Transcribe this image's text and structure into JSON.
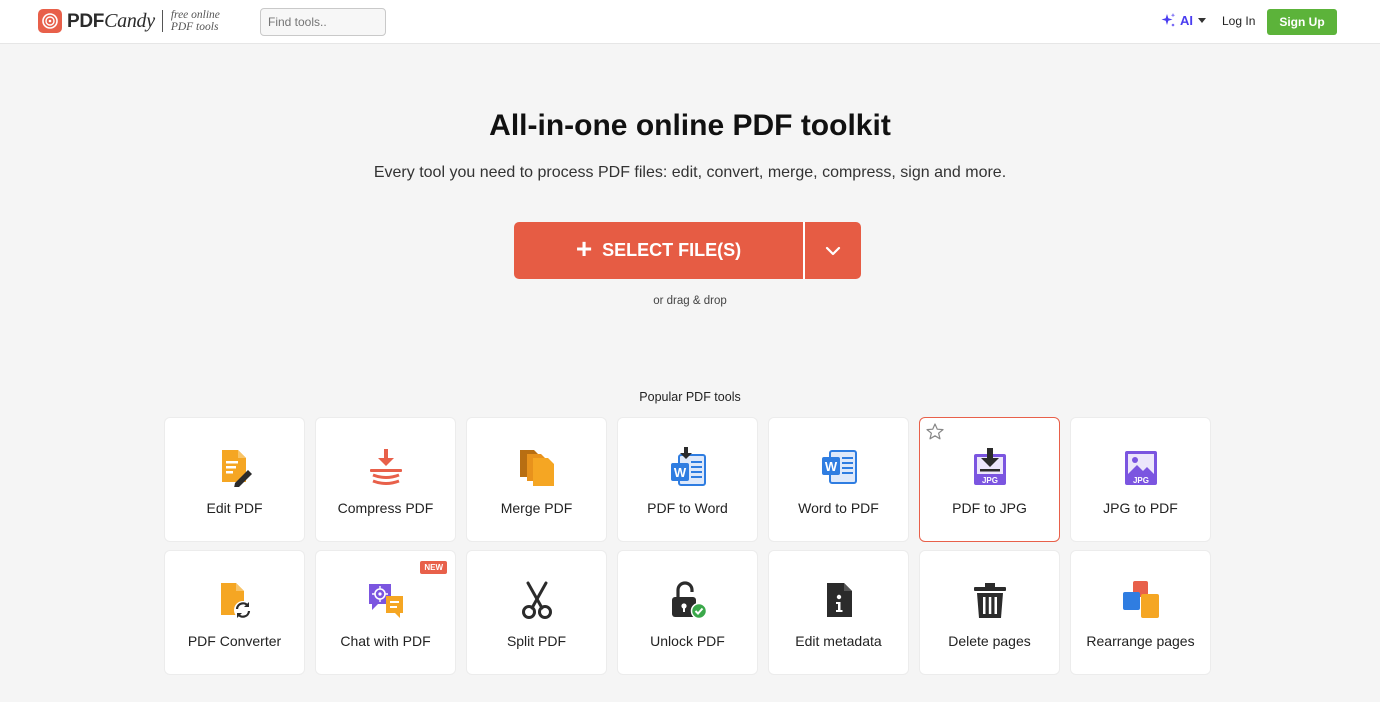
{
  "header": {
    "logo_text_a": "PDF",
    "logo_text_b": "Candy",
    "tagline_1": "free online",
    "tagline_2": "PDF tools",
    "search_placeholder": "Find tools..",
    "ai_label": "AI",
    "login_label": "Log In",
    "signup_label": "Sign Up"
  },
  "hero": {
    "title": "All-in-one online PDF toolkit",
    "subtitle": "Every tool you need to process PDF files: edit, convert, merge, compress, sign and more.",
    "select_label": "SELECT FILE(S)",
    "drag_drop": "or drag & drop"
  },
  "tools": {
    "heading": "Popular PDF tools",
    "items": [
      {
        "label": "Edit PDF",
        "icon": "edit-pdf-icon"
      },
      {
        "label": "Compress PDF",
        "icon": "compress-icon"
      },
      {
        "label": "Merge PDF",
        "icon": "merge-icon"
      },
      {
        "label": "PDF to Word",
        "icon": "pdf-to-word-icon"
      },
      {
        "label": "Word to PDF",
        "icon": "word-icon"
      },
      {
        "label": "PDF to JPG",
        "icon": "pdf-to-jpg-icon",
        "badge_text": "JPG"
      },
      {
        "label": "JPG to PDF",
        "icon": "jpg-image-icon",
        "badge_text": "JPG"
      },
      {
        "label": "PDF Converter",
        "icon": "converter-icon"
      },
      {
        "label": "Chat with PDF",
        "icon": "chat-icon",
        "badge": "NEW"
      },
      {
        "label": "Split PDF",
        "icon": "scissors-icon"
      },
      {
        "label": "Unlock PDF",
        "icon": "unlock-icon"
      },
      {
        "label": "Edit metadata",
        "icon": "info-file-icon"
      },
      {
        "label": "Delete pages",
        "icon": "trash-icon"
      },
      {
        "label": "Rearrange pages",
        "icon": "rearrange-icon"
      }
    ]
  },
  "colors": {
    "brand": "#e8604a",
    "signup": "#5cb33a",
    "ai": "#4a3df0",
    "icon_orange": "#f5a623",
    "icon_blue": "#2f7de1",
    "icon_purple": "#7b55e0"
  }
}
